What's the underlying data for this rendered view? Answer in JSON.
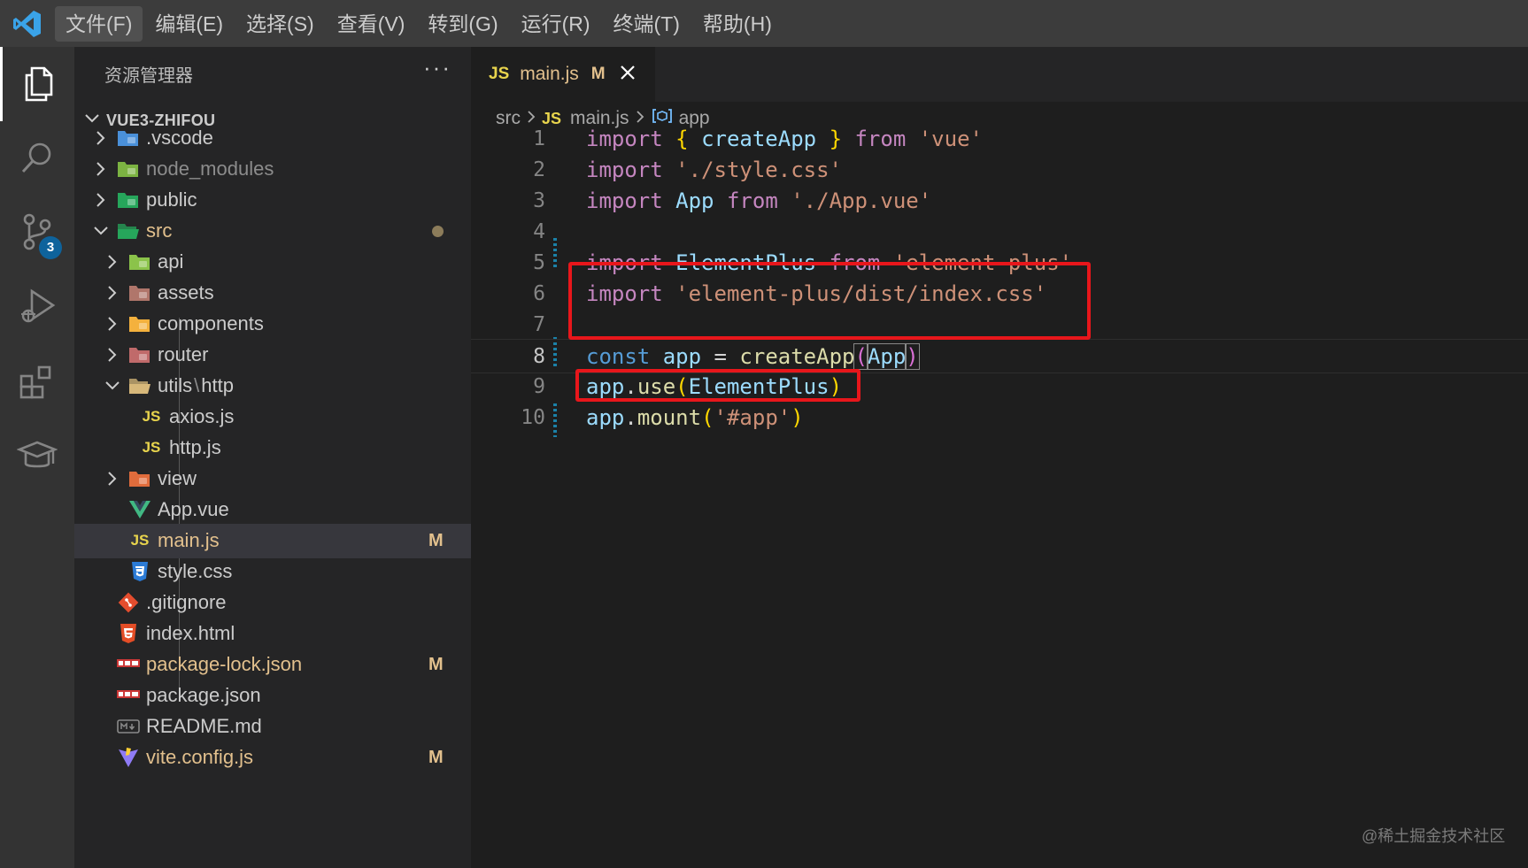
{
  "menubar": {
    "items": [
      "文件(F)",
      "编辑(E)",
      "选择(S)",
      "查看(V)",
      "转到(G)",
      "运行(R)",
      "终端(T)",
      "帮助(H)"
    ]
  },
  "activitybar": {
    "items": [
      "files-icon",
      "search-icon",
      "source-control-icon",
      "run-debug-icon",
      "extensions-icon",
      "learn-icon"
    ],
    "source_control_badge": "3"
  },
  "sidebar": {
    "title": "资源管理器",
    "more": "···",
    "project": "VUE3-ZHIFOU",
    "tree": [
      {
        "label": ".vscode",
        "depth": 1,
        "kind": "folder",
        "icon_color": "#4a90d9"
      },
      {
        "label": "node_modules",
        "depth": 1,
        "kind": "folder",
        "icon_color": "#7cb342",
        "dim": true
      },
      {
        "label": "public",
        "depth": 1,
        "kind": "folder",
        "icon_color": "#26a65b"
      },
      {
        "label": "src",
        "depth": 1,
        "kind": "folder-open",
        "icon_color": "#26a65b",
        "mod": true,
        "dot": true
      },
      {
        "label": "api",
        "depth": 2,
        "kind": "folder",
        "icon_color": "#8bc34a"
      },
      {
        "label": "assets",
        "depth": 2,
        "kind": "folder",
        "icon_color": "#b0766b"
      },
      {
        "label": "components",
        "depth": 2,
        "kind": "folder",
        "icon_color": "#f4b13d"
      },
      {
        "label": "router",
        "depth": 2,
        "kind": "folder",
        "icon_color": "#c06a6a"
      },
      {
        "label": "utils",
        "label_sep": "\\",
        "label_suffix": "http",
        "depth": 2,
        "kind": "folder-open",
        "icon_color": "#d7b87a"
      },
      {
        "label": "axios.js",
        "depth": 3,
        "kind": "js"
      },
      {
        "label": "http.js",
        "depth": 3,
        "kind": "js"
      },
      {
        "label": "view",
        "depth": 2,
        "kind": "folder",
        "icon_color": "#e06c3c"
      },
      {
        "label": "App.vue",
        "depth": 2,
        "kind": "vue"
      },
      {
        "label": "main.js",
        "depth": 2,
        "kind": "js",
        "mod": true,
        "status": "M",
        "selected": true
      },
      {
        "label": "style.css",
        "depth": 2,
        "kind": "css"
      },
      {
        "label": ".gitignore",
        "depth": 1,
        "kind": "git"
      },
      {
        "label": "index.html",
        "depth": 1,
        "kind": "html"
      },
      {
        "label": "package-lock.json",
        "depth": 1,
        "kind": "npm",
        "mod": true,
        "status": "M"
      },
      {
        "label": "package.json",
        "depth": 1,
        "kind": "npm"
      },
      {
        "label": "README.md",
        "depth": 1,
        "kind": "md"
      },
      {
        "label": "vite.config.js",
        "depth": 1,
        "kind": "vite",
        "mod": true,
        "status": "M"
      }
    ]
  },
  "tab": {
    "icon": "JS",
    "name": "main.js",
    "status": "M",
    "close": "✕"
  },
  "breadcrumb": {
    "folder": "src",
    "file_icon": "JS",
    "file": "main.js",
    "symbol": "app"
  },
  "editor": {
    "current_line": 8,
    "lines": [
      {
        "n": "1",
        "tokens": [
          [
            "kw",
            "import"
          ],
          [
            "plain",
            " "
          ],
          [
            "brk",
            "{"
          ],
          [
            "plain",
            " "
          ],
          [
            "var",
            "createApp"
          ],
          [
            "plain",
            " "
          ],
          [
            "brk",
            "}"
          ],
          [
            "plain",
            " "
          ],
          [
            "kw",
            "from"
          ],
          [
            "plain",
            " "
          ],
          [
            "str",
            "'vue'"
          ]
        ]
      },
      {
        "n": "2",
        "tokens": [
          [
            "kw",
            "import"
          ],
          [
            "plain",
            " "
          ],
          [
            "str",
            "'./style.css'"
          ]
        ]
      },
      {
        "n": "3",
        "tokens": [
          [
            "kw",
            "import"
          ],
          [
            "plain",
            " "
          ],
          [
            "var",
            "App"
          ],
          [
            "plain",
            " "
          ],
          [
            "kw",
            "from"
          ],
          [
            "plain",
            " "
          ],
          [
            "str",
            "'./App.vue'"
          ]
        ]
      },
      {
        "n": "4",
        "tokens": []
      },
      {
        "n": "5",
        "tokens": [
          [
            "kw",
            "import"
          ],
          [
            "plain",
            " "
          ],
          [
            "var",
            "ElementPlus"
          ],
          [
            "plain",
            " "
          ],
          [
            "kw",
            "from"
          ],
          [
            "plain",
            " "
          ],
          [
            "str",
            "'element-plus'"
          ]
        ]
      },
      {
        "n": "6",
        "tokens": [
          [
            "kw",
            "import"
          ],
          [
            "plain",
            " "
          ],
          [
            "str",
            "'element-plus/dist/index.css'"
          ]
        ]
      },
      {
        "n": "7",
        "tokens": []
      },
      {
        "n": "8",
        "tokens": [
          [
            "kb",
            "const"
          ],
          [
            "plain",
            " "
          ],
          [
            "ident",
            "app"
          ],
          [
            "plain",
            " = "
          ],
          [
            "fn",
            "createApp"
          ],
          [
            "brk-m",
            "("
          ],
          [
            "ident-m",
            "App"
          ],
          [
            "brk-m",
            ")"
          ]
        ]
      },
      {
        "n": "9",
        "tokens": [
          [
            "ident",
            "app"
          ],
          [
            "plain",
            "."
          ],
          [
            "fn",
            "use"
          ],
          [
            "brk",
            "("
          ],
          [
            "ident",
            "ElementPlus"
          ],
          [
            "brk",
            ")"
          ]
        ]
      },
      {
        "n": "10",
        "tokens": [
          [
            "ident",
            "app"
          ],
          [
            "plain",
            "."
          ],
          [
            "fn",
            "mount"
          ],
          [
            "brk",
            "("
          ],
          [
            "str",
            "'#app'"
          ],
          [
            "brk",
            ")"
          ]
        ]
      }
    ]
  },
  "watermark": "@稀土掘金技术社区",
  "colors": {
    "highlight": "#e8161b",
    "modified": "#e2c08d",
    "badge": "#0e639c"
  }
}
